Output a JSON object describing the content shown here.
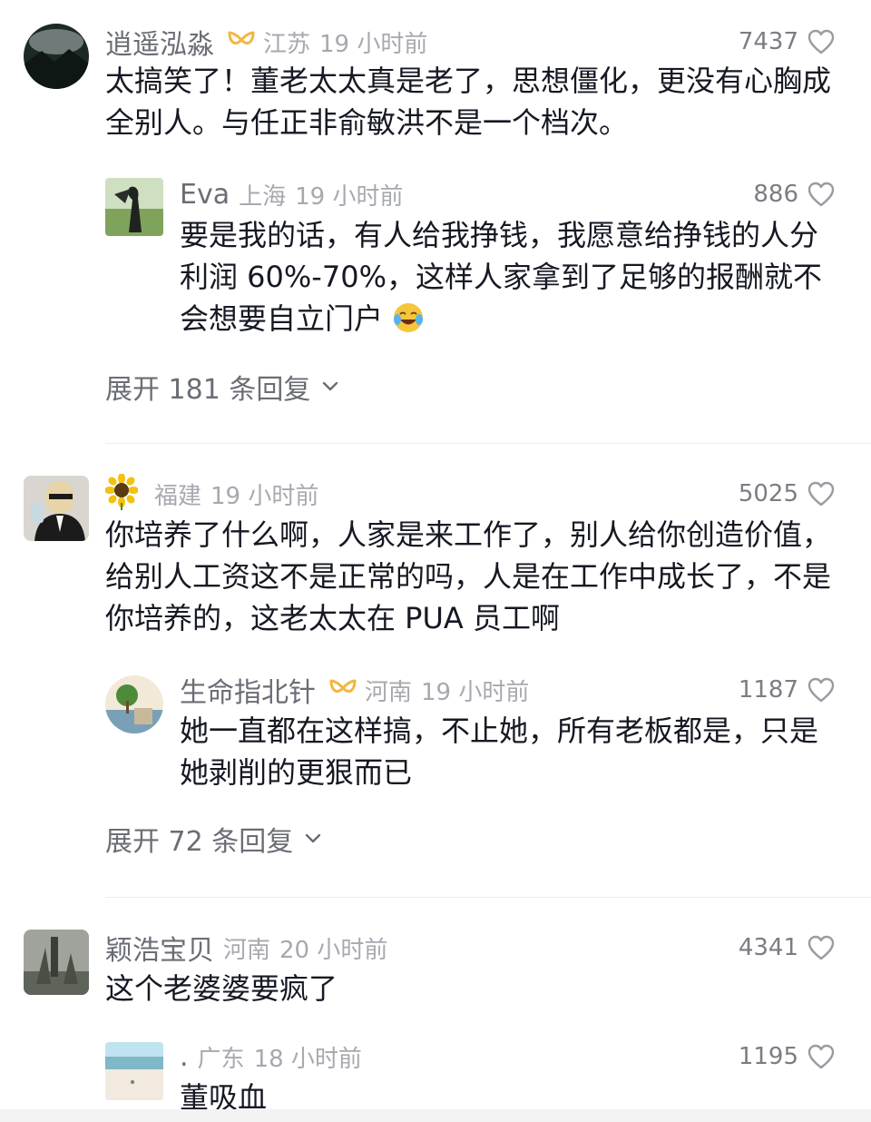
{
  "comments": [
    {
      "user": "逍遥泓淼",
      "location": "江苏",
      "time": "19 小时前",
      "likes": "7437",
      "text": "太搞笑了！董老太太真是老了，思想僵化，更没有心胸成全别人。与任正非俞敏洪不是一个档次。",
      "reply": {
        "user": "Eva",
        "location": "上海",
        "time": "19 小时前",
        "likes": "886",
        "text": "要是我的话，有人给我挣钱，我愿意给挣钱的人分利润 60%-70%，这样人家拿到了足够的报酬就不会想要自立门户"
      },
      "expand": "展开 181 条回复"
    },
    {
      "user": "",
      "location": "福建",
      "time": "19 小时前",
      "likes": "5025",
      "text": "你培养了什么啊，人家是来工作了，别人给你创造价值，给别人工资这不是正常的吗，人是在工作中成长了，不是你培养的，这老太太在 PUA 员工啊",
      "reply": {
        "user": "生命指北针",
        "location": "河南",
        "time": "19 小时前",
        "likes": "1187",
        "text": "她一直都在这样搞，不止她，所有老板都是，只是她剥削的更狠而已"
      },
      "expand": "展开 72 条回复"
    },
    {
      "user": "颖浩宝贝",
      "location": "河南",
      "time": "20 小时前",
      "likes": "4341",
      "text": "这个老婆婆要疯了",
      "reply": {
        "user": ".",
        "location": "广东",
        "time": "18 小时前",
        "likes": "1195",
        "text": "董吸血"
      }
    }
  ],
  "colors": {
    "name": "#6b6d75",
    "meta": "#a7a9b0",
    "text": "#161823",
    "badge": "#f2b740"
  }
}
